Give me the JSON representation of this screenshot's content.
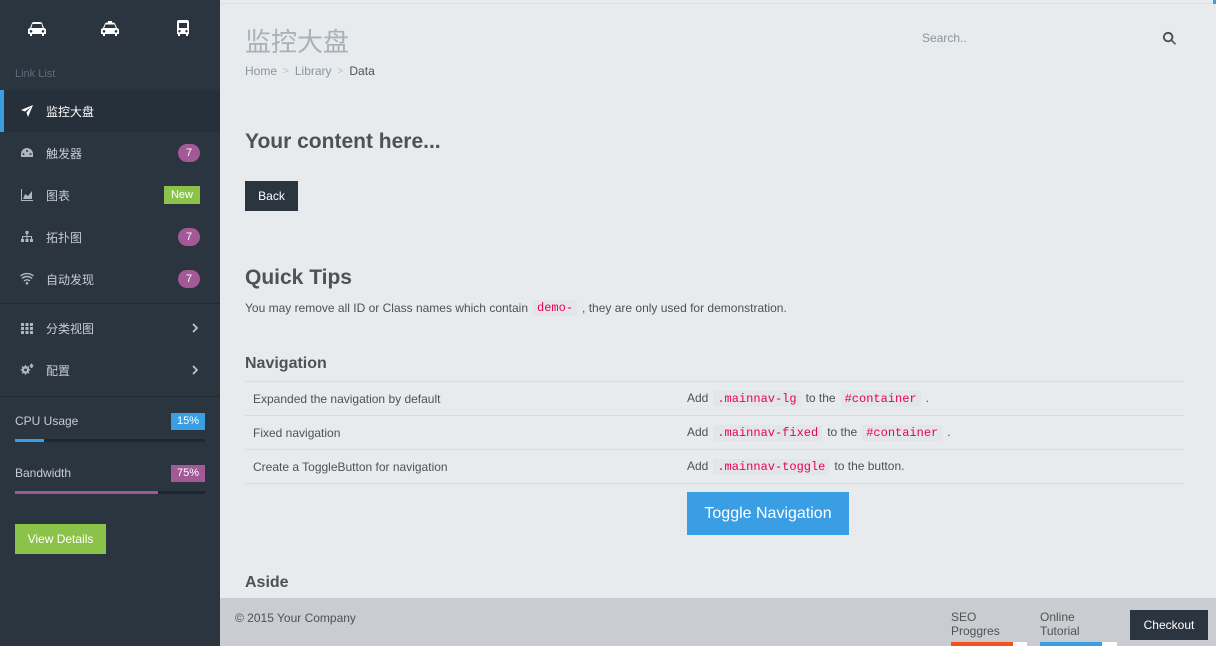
{
  "sidebar": {
    "shortcuts": [
      "car-icon",
      "taxi-icon",
      "bus-icon"
    ],
    "link_header": "Link List",
    "items": [
      {
        "label": "监控大盘",
        "icon": "plane-icon",
        "active": true
      },
      {
        "label": "触发器",
        "icon": "dashboard-icon",
        "badge": "7"
      },
      {
        "label": "图表",
        "icon": "area-chart-icon",
        "badge_new": "New"
      },
      {
        "label": "拓扑图",
        "icon": "sitemap-icon",
        "badge": "7"
      },
      {
        "label": "自动发现",
        "icon": "wifi-icon",
        "badge": "7"
      },
      {
        "label": "分类视图",
        "icon": "grid-icon",
        "chevron": true
      },
      {
        "label": "配置",
        "icon": "gears-icon",
        "chevron": true
      }
    ],
    "stats": [
      {
        "label": "CPU Usage",
        "value": "15%",
        "percent": 15,
        "color": "#3a9ee4"
      },
      {
        "label": "Bandwidth",
        "value": "75%",
        "percent": 75,
        "color": "#a35996"
      }
    ],
    "details_button": "View Details"
  },
  "header": {
    "title": "监控大盘",
    "breadcrumb": [
      "Home",
      "Library",
      "Data"
    ],
    "search_placeholder": "Search.."
  },
  "main": {
    "heading": "Your content here...",
    "back_button": "Back",
    "tips_heading": "Quick Tips",
    "tips_text_before": "You may remove all ID or Class names which contain",
    "tips_code": "demo-",
    "tips_text_after": ", they are only used for demonstration.",
    "navigation_heading": "Navigation",
    "navigation_rows": [
      {
        "desc": "Expanded the navigation by default",
        "pre": "Add",
        "code1": ".mainnav-lg",
        "mid": "to the",
        "code2": "#container",
        "post": "."
      },
      {
        "desc": "Fixed navigation",
        "pre": "Add",
        "code1": ".mainnav-fixed",
        "mid": "to the",
        "code2": "#container",
        "post": "."
      },
      {
        "desc": "Create a ToggleButton for navigation",
        "pre": "Add",
        "code1": ".mainnav-toggle",
        "mid": "to the button.",
        "code2": "",
        "post": ""
      }
    ],
    "toggle_button": "Toggle Navigation",
    "aside_heading": "Aside"
  },
  "footer": {
    "copyright": "© 2015 Your Company",
    "progress": [
      {
        "label": "SEO Proggres",
        "percent": 82,
        "color": "#f4511e"
      },
      {
        "label": "Online Tutorial",
        "percent": 80,
        "color": "#3a9ee4"
      }
    ],
    "checkout_button": "Checkout"
  },
  "colors": {
    "sidebar_bg": "#2b3540",
    "accent": "#3a9ee4",
    "badge": "#a35996",
    "new_badge": "#8bc34a",
    "code": "#e9004f"
  }
}
